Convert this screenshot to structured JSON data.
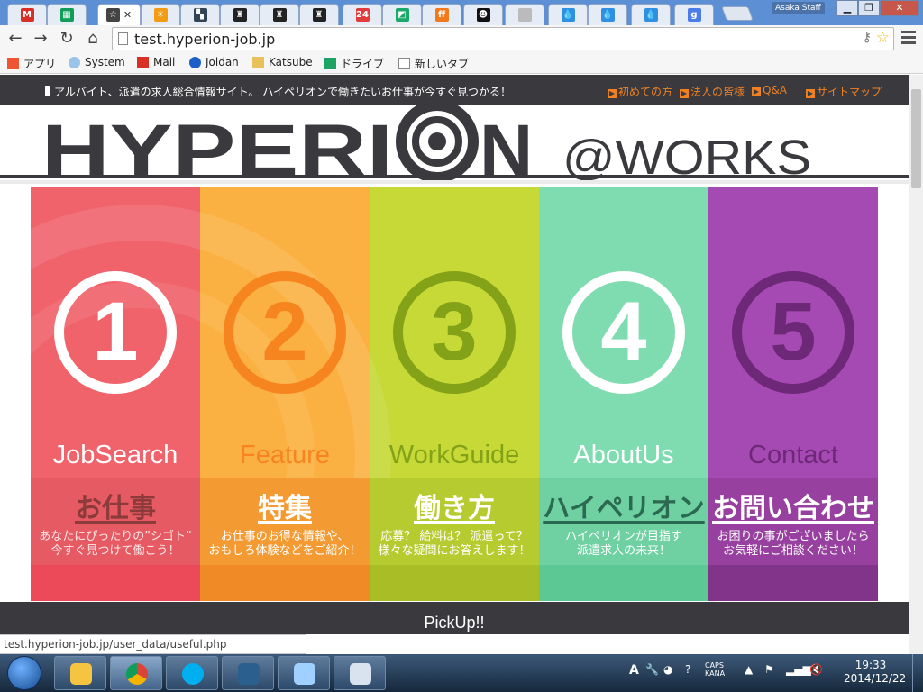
{
  "browser": {
    "tabs": [
      {
        "name": "gmail",
        "color": "#d93025",
        "glyph": "M"
      },
      {
        "name": "sheets",
        "color": "#0f9d58",
        "glyph": "▦"
      },
      {
        "name": "active",
        "color": "#444",
        "glyph": "☆",
        "close": "✕"
      },
      {
        "name": "sun",
        "color": "#f39c12",
        "glyph": "☀"
      },
      {
        "name": "news",
        "color": "#345",
        "glyph": "▚"
      },
      {
        "name": "shield1",
        "color": "#222",
        "glyph": "♜"
      },
      {
        "name": "shield2",
        "color": "#222",
        "glyph": "♜"
      },
      {
        "name": "shield3",
        "color": "#222",
        "glyph": "♜"
      },
      {
        "name": "24-7",
        "color": "#e23b3b",
        "glyph": "24"
      },
      {
        "name": "green",
        "color": "#1aa86b",
        "glyph": "◩"
      },
      {
        "name": "ff",
        "color": "#f27a1a",
        "glyph": "ff"
      },
      {
        "name": "cat",
        "color": "#111",
        "glyph": "☻"
      },
      {
        "name": "doc1",
        "color": "#bbb",
        "glyph": ""
      },
      {
        "name": "drop1",
        "color": "#2f8fe0",
        "glyph": "💧"
      },
      {
        "name": "drop2",
        "color": "#2f8fe0",
        "glyph": "💧"
      },
      {
        "name": "drop3",
        "color": "#2f8fe0",
        "glyph": "💧"
      },
      {
        "name": "google",
        "color": "#4a7de8",
        "glyph": "g"
      }
    ],
    "profile_name": "Asaka Staff",
    "url": "test.hyperion-job.jp",
    "bookmarks": [
      {
        "label": "アプリ",
        "icon": "apps-icon"
      },
      {
        "label": "System",
        "icon": "cloud-icon"
      },
      {
        "label": "Mail",
        "icon": "gmail-icon"
      },
      {
        "label": "Joldan",
        "icon": "joldan-icon"
      },
      {
        "label": "Katsube",
        "icon": "folder-icon"
      },
      {
        "label": "ドライブ",
        "icon": "drive-icon"
      },
      {
        "label": "新しいタブ",
        "icon": "page-icon"
      }
    ],
    "status_url": "test.hyperion-job.jp/user_data/useful.php"
  },
  "site": {
    "tagline": "アルバイト、派遣の求人総合情報サイト。 ハイペリオンで働きたいお仕事が今すぐ見つかる！",
    "top_links": [
      "初めての方",
      "法人の皆様",
      "Q&A",
      "サイトマップ"
    ],
    "logo_text": "HYPERI",
    "logo_text2": "N",
    "logo_works": "@WORKS",
    "panels": [
      {
        "num": "1",
        "en": "JobSearch",
        "jp": "お仕事",
        "desc": "あなたにぴったりの”シゴト”\n今すぐ見つけて働こう！",
        "bg": "#f0636b",
        "band": "#e55a63",
        "foot": "#ec4a58",
        "circle": "#ffffff",
        "en_color": "#ffffff",
        "jp_color": "#8c3a3a",
        "desc_color": "#ffe7e7"
      },
      {
        "num": "2",
        "en": "Feature",
        "jp": "特集",
        "desc": "お仕事のお得な情報や、\nおもしろ体験などをご紹介！",
        "bg": "#fbb142",
        "band": "#f39a33",
        "foot": "#f08a26",
        "circle": "#f7851f",
        "en_color": "#f7851f",
        "jp_color": "#ffffff",
        "desc_color": "#ffffff"
      },
      {
        "num": "3",
        "en": "WorkGuide",
        "jp": "働き方",
        "desc": "応募？ 給料は？ 派遣って？\n様々な疑問にお答えします！",
        "bg": "#c6d937",
        "band": "#b6cb2f",
        "foot": "#a9be26",
        "circle": "#84a218",
        "en_color": "#84a218",
        "jp_color": "#ffffff",
        "desc_color": "#ffffff"
      },
      {
        "num": "4",
        "en": "AboutUs",
        "jp": "ハイペリオン",
        "desc": "ハイペリオンが目指す\n派遣求人の未来！",
        "bg": "#7fdcb0",
        "band": "#6fd1a2",
        "foot": "#5cc995",
        "circle": "#ffffff",
        "en_color": "#ffffff",
        "jp_color": "#2b6a50",
        "desc_color": "#ffffff"
      },
      {
        "num": "5",
        "en": "Contact",
        "jp": "お問い合わせ",
        "desc": "お困りの事がございましたら\nお気軽にご相談ください！",
        "bg": "#a64ab3",
        "band": "#97409f",
        "foot": "#82348a",
        "circle": "#6d2877",
        "en_color": "#6d2877",
        "jp_color": "#ffffff",
        "desc_color": "#ffffff"
      }
    ],
    "pickup_label": "PickUp!!"
  },
  "taskbar": {
    "apps": [
      "explorer",
      "chrome",
      "skype",
      "app",
      "notepad",
      "calculator"
    ],
    "tray": {
      "ime_a": "A",
      "caps": "CAPS",
      "kana": "KANA"
    },
    "time": "19:33",
    "date": "2014/12/22"
  },
  "colors": {
    "accent_orange": "#f08020",
    "dark": "#3a3a3e",
    "tab_bar": "#5d8fd4"
  }
}
